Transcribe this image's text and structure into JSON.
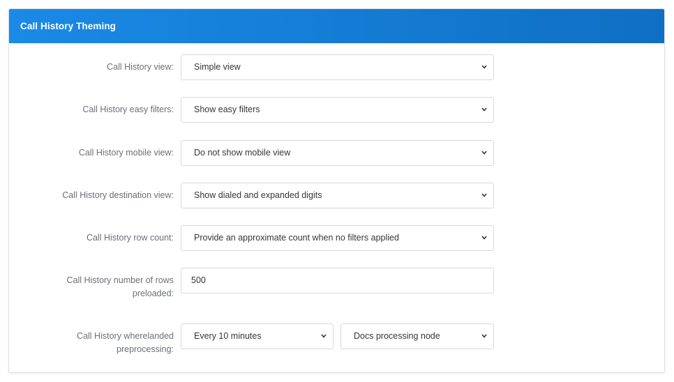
{
  "panel": {
    "title": "Call History Theming"
  },
  "fields": {
    "view": {
      "label": "Call History view:",
      "value": "Simple view"
    },
    "easy_filters": {
      "label": "Call History easy filters:",
      "value": "Show easy filters"
    },
    "mobile_view": {
      "label": "Call History mobile view:",
      "value": "Do not show mobile view"
    },
    "destination_view": {
      "label": "Call History destination view:",
      "value": "Show dialed and expanded digits"
    },
    "row_count": {
      "label": "Call History row count:",
      "value": "Provide an approximate count when no filters applied"
    },
    "rows_preloaded": {
      "label_line1": "Call History number of rows",
      "label_line2": "preloaded:",
      "value": "500"
    },
    "wherelanded": {
      "label_line1": "Call History wherelanded",
      "label_line2": "preprocessing:",
      "interval_value": "Every 10 minutes",
      "node_value": "Docs processing node"
    }
  },
  "icons": {
    "select_arrow": "chevron-down-icon"
  },
  "colors": {
    "header_start": "#1a8ae6",
    "header_end": "#0f6fc4",
    "label_text": "#6b6f75",
    "control_border": "#d6d9dd"
  }
}
